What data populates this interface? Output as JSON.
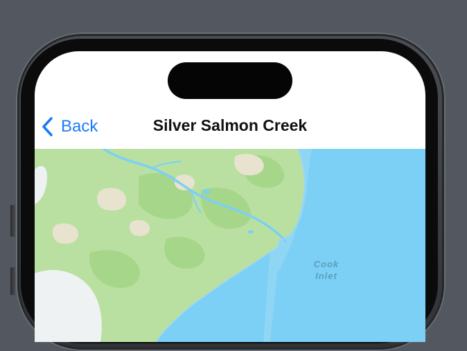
{
  "nav": {
    "back_label": "Back",
    "title": "Silver Salmon Creek"
  },
  "map": {
    "water_label_line1": "Cook",
    "water_label_line2": "Inlet"
  },
  "colors": {
    "accent": "#1a7cf5",
    "water": "#7ccff5",
    "land": "#b9e0a0",
    "sand": "#e7e3cf"
  }
}
